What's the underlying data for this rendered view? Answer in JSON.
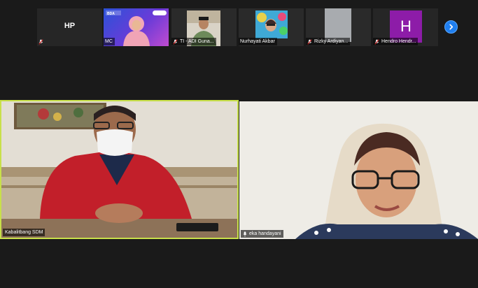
{
  "gallery_strip": {
    "tiles": [
      {
        "initials": "HP",
        "label": ""
      },
      {
        "label": "MC",
        "banner": "BDA"
      },
      {
        "label": "TI - ADI Guna..."
      },
      {
        "label": "Nurhayati Akbar"
      },
      {
        "label": "Rizky Ardiyan..."
      },
      {
        "initials": "H",
        "label": "Hendro Hendr..."
      }
    ],
    "next_icon": "chevron-right-icon",
    "colors": {
      "tile_bg": "#262626",
      "avatar_h": "#8d1ca8",
      "next_button": "#1f7ff0"
    }
  },
  "videos": {
    "left": {
      "label": "Kabalitbang SDM",
      "active_speaker_border": "#c8e04a"
    },
    "right": {
      "label": "eka handayani"
    }
  }
}
